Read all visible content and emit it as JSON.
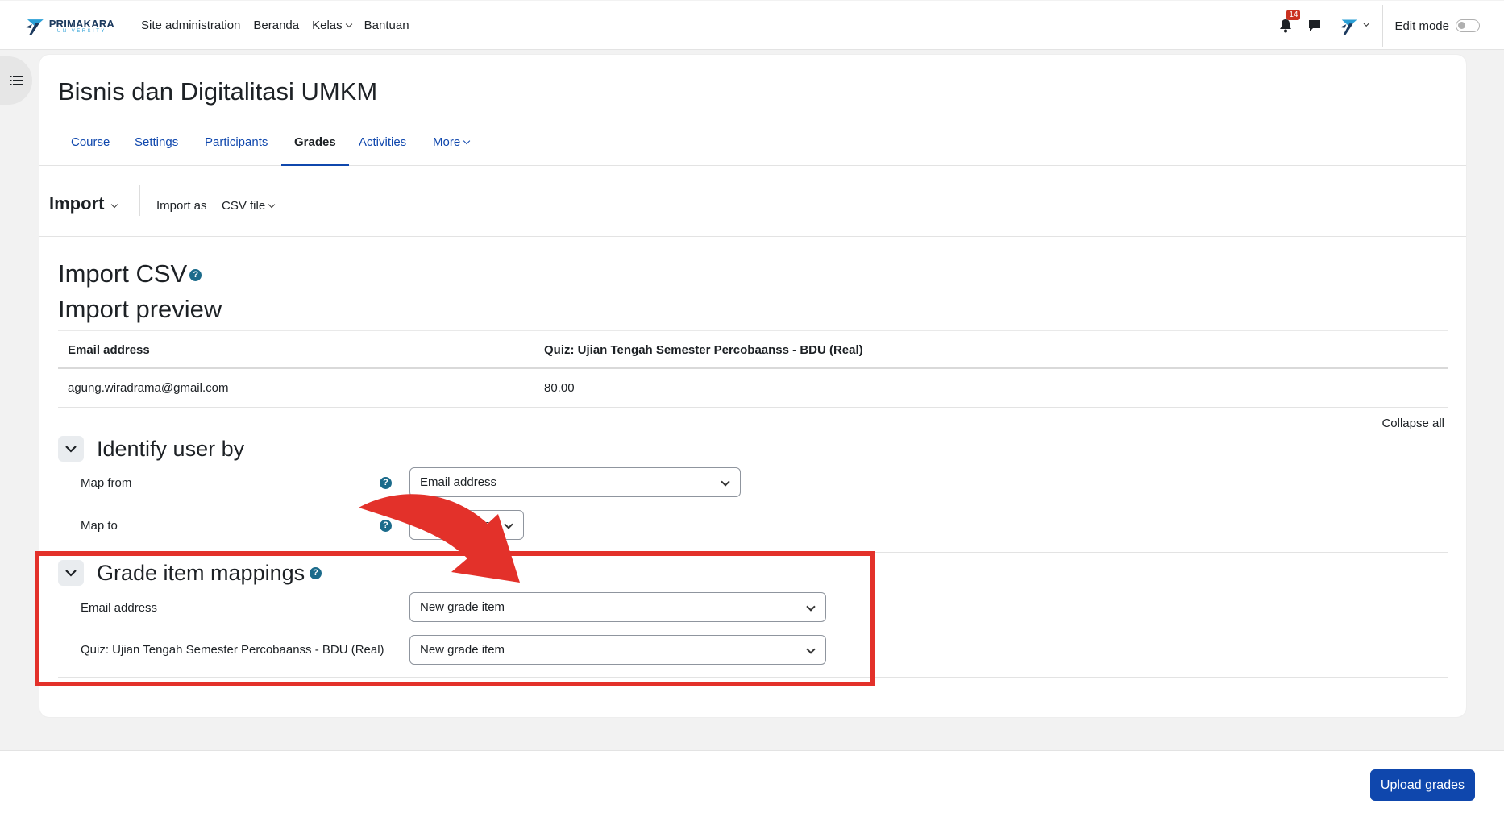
{
  "brand": {
    "main": "PRIMAKARA",
    "sub": "UNIVERSITY"
  },
  "topnav": {
    "site_admin": "Site administration",
    "beranda": "Beranda",
    "kelas": "Kelas",
    "bantuan": "Bantuan"
  },
  "notifications": {
    "count": "14",
    "icon": "bell-icon"
  },
  "edit_mode": {
    "label": "Edit mode",
    "state": false
  },
  "course": {
    "title": "Bisnis dan Digitalitasi UMKM"
  },
  "tabs": [
    {
      "label": "Course",
      "active": false
    },
    {
      "label": "Settings",
      "active": false
    },
    {
      "label": "Participants",
      "active": false
    },
    {
      "label": "Grades",
      "active": true
    },
    {
      "label": "Activities",
      "active": false
    },
    {
      "label": "More",
      "active": false
    }
  ],
  "tertiary": {
    "import_label": "Import",
    "import_as_label": "Import as",
    "import_as_value": "CSV file"
  },
  "headings": {
    "import_csv": "Import CSV",
    "import_preview": "Import preview"
  },
  "preview": {
    "columns": [
      "Email address",
      "Quiz: Ujian Tengah Semester Percobaanss - BDU (Real)"
    ],
    "rows": [
      [
        "agung.wiradrama@gmail.com",
        "80.00"
      ]
    ]
  },
  "collapse_all": "Collapse all",
  "identify": {
    "title": "Identify user by",
    "map_from_label": "Map from",
    "map_from_value": "Email address",
    "map_to_label": "Map to",
    "map_to_value": "Email address"
  },
  "grade_mappings": {
    "title": "Grade item mappings",
    "rows": [
      {
        "label": "Email address",
        "value": "New grade item"
      },
      {
        "label": "Quiz: Ujian Tengah Semester Percobaanss - BDU (Real)",
        "value": "New grade item"
      }
    ]
  },
  "footer": {
    "upload_button": "Upload grades"
  },
  "colors": {
    "accent": "#0f47ad",
    "annotation": "#e3312a",
    "badge": "#ca3120"
  }
}
